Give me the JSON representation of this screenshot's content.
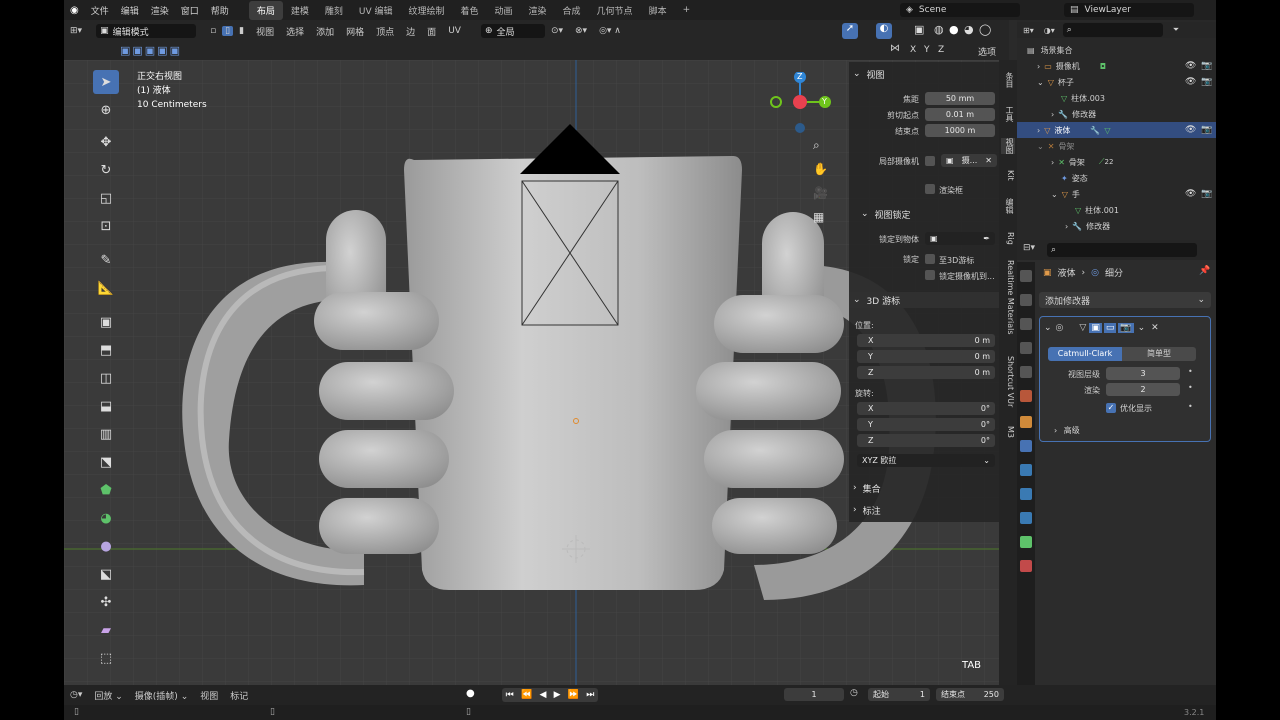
{
  "topbar": {
    "menus": [
      "文件",
      "编辑",
      "渲染",
      "窗口",
      "帮助"
    ],
    "workspaces": [
      "布局",
      "建模",
      "雕刻",
      "UV 编辑",
      "纹理绘制",
      "着色",
      "动画",
      "渲染",
      "合成",
      "几何节点",
      "脚本"
    ],
    "active_workspace": "布局",
    "add_tab": "+",
    "scene": "Scene",
    "view_layer": "ViewLayer"
  },
  "viewport_header": {
    "mode": "编辑模式",
    "menus": [
      "视图",
      "选择",
      "添加",
      "网格",
      "顶点",
      "边",
      "面",
      "UV"
    ],
    "orientation": "全局",
    "xyz": [
      "X",
      "Y",
      "Z"
    ],
    "options": "选项"
  },
  "viewport": {
    "view_name": "正交右视图",
    "object_name": "(1) 液体",
    "scale_text": "10 Centimeters",
    "tab_hint": "TAB",
    "gizmo_labels": [
      "Z",
      "Y"
    ]
  },
  "npanel": {
    "view_section": "视图",
    "focal_label": "焦距",
    "focal_value": "50 mm",
    "clip_start_label": "剪切起点",
    "clip_start_value": "0.01 m",
    "clip_end_label": "结束点",
    "clip_end_value": "1000 m",
    "local_camera_label": "局部摄像机",
    "local_camera_value": "摄...",
    "render_region": "渲染框",
    "view_lock_section": "视图锁定",
    "lock_to_object_label": "锁定到物体",
    "lock_label": "锁定",
    "to_3d_cursor": "至3D游标",
    "lock_camera": "锁定摄像机到...",
    "cursor_section": "3D 游标",
    "location_label": "位置:",
    "loc_x_label": "X",
    "loc_x": "0 m",
    "loc_y_label": "Y",
    "loc_y": "0 m",
    "loc_z_label": "Z",
    "loc_z": "0 m",
    "rotation_label": "旋转:",
    "rot_x_label": "X",
    "rot_x": "0°",
    "rot_y_label": "Y",
    "rot_y": "0°",
    "rot_z_label": "Z",
    "rot_z": "0°",
    "rotation_mode": "XYZ 欧拉",
    "collections_section": "集合",
    "annotations_section": "标注"
  },
  "npanel_tabs": [
    "条目",
    "工具",
    "视图",
    "Kit",
    "编辑",
    "Rig",
    "Realtime Materials",
    "Shortcut VUr",
    "M3"
  ],
  "outliner": {
    "root": "场景集合",
    "rows": [
      {
        "label": "摄像机",
        "indent": 1
      },
      {
        "label": "杯子",
        "indent": 1
      },
      {
        "label": "柱体.003",
        "indent": 2
      },
      {
        "label": "修改器",
        "indent": 2
      },
      {
        "label": "液体",
        "indent": 1
      },
      {
        "label": "骨架",
        "indent": 1
      },
      {
        "label": "骨架",
        "indent": 2
      },
      {
        "label": "姿态",
        "indent": 2
      },
      {
        "label": "手",
        "indent": 2
      },
      {
        "label": "柱体.001",
        "indent": 3
      },
      {
        "label": "修改器",
        "indent": 3
      }
    ],
    "bone_count": "22"
  },
  "properties": {
    "object_name": "液体",
    "subdiv_name": "细分",
    "add_modifier": "添加修改器",
    "catmull": "Catmull-Clark",
    "simple": "简单型",
    "viewport_levels_label": "视图层级",
    "viewport_levels": "3",
    "render_label": "渲染",
    "render_levels": "2",
    "optimal_display": "优化显示",
    "advanced": "高级"
  },
  "timeline": {
    "playback": "回放",
    "keying": "摄像(插帧)",
    "view": "视图",
    "marker": "标记",
    "current_frame": "1",
    "start_label": "起始",
    "start": "1",
    "end_label": "结束点",
    "end": "250"
  },
  "status": {
    "version": "3.2.1"
  },
  "colors": {
    "accent": "#4772b3",
    "selected_row": "#334d80",
    "x_axis": "#e8414f",
    "y_axis": "#6fc41c",
    "z_axis": "#2f86d6",
    "mesh": "#c8c8c8"
  }
}
